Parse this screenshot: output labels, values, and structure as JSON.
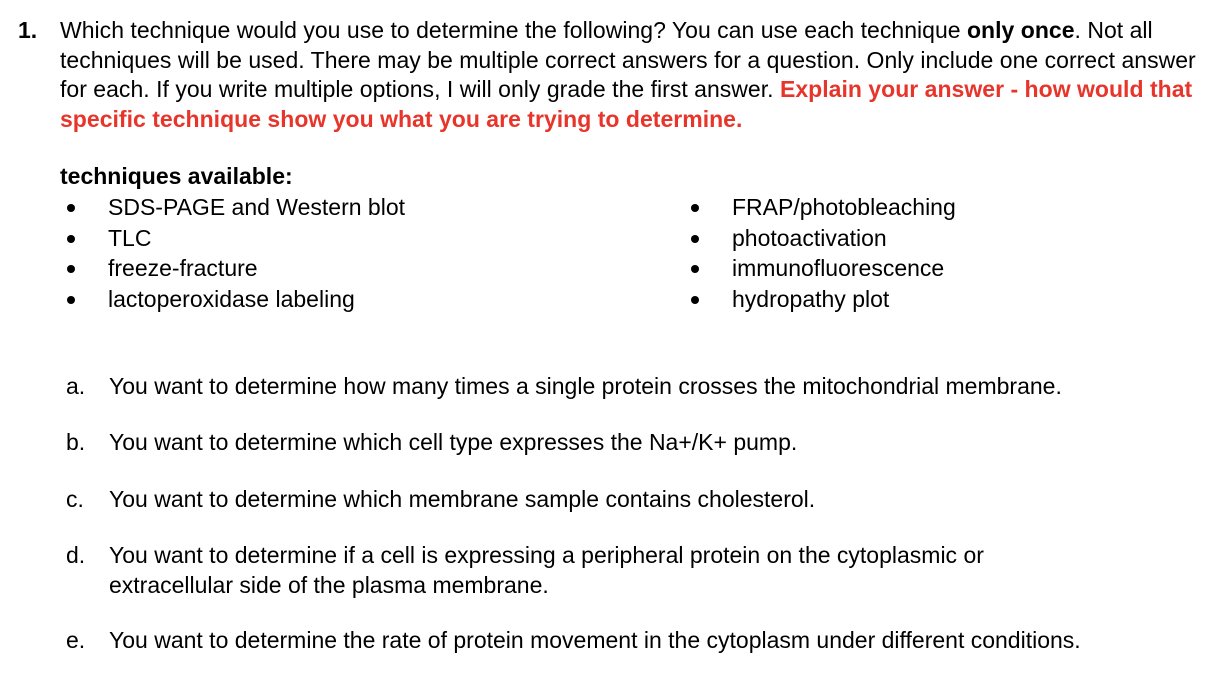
{
  "question": {
    "number": "1.",
    "intro_plain_1": "Which technique would you use to determine the following? You can use each technique ",
    "intro_bold": "only once",
    "intro_plain_2": ". Not all techniques will be used. There may be multiple correct answers for a question. Only include one correct answer for each. If you write multiple options, I will only grade the first answer. ",
    "intro_red": "Explain your answer - how would that specific technique show you what you are trying to determine.",
    "accent_color": "#e8352b"
  },
  "techniques": {
    "heading": "techniques available:",
    "left": [
      {
        "label": "SDS-PAGE and Western blot"
      },
      {
        "label": "TLC"
      },
      {
        "label": "freeze-fracture"
      },
      {
        "label": "lactoperoxidase labeling"
      }
    ],
    "right": [
      {
        "label": "FRAP/photobleaching"
      },
      {
        "label": "photoactivation"
      },
      {
        "label": "immunofluorescence"
      },
      {
        "label": "hydropathy plot"
      }
    ]
  },
  "sub_questions": [
    {
      "letter": "a.",
      "text": "You want to determine how many times a single protein crosses the mitochondrial membrane."
    },
    {
      "letter": "b.",
      "text": "You want to determine which cell type expresses the Na+/K+ pump."
    },
    {
      "letter": "c.",
      "text": "You want to determine which membrane sample contains cholesterol."
    },
    {
      "letter": "d.",
      "text": "You want to determine if a cell is expressing a peripheral protein on the cytoplasmic or extracellular side of the plasma membrane."
    },
    {
      "letter": "e.",
      "text": "You want to determine the rate of protein movement in the cytoplasm under different conditions."
    }
  ]
}
